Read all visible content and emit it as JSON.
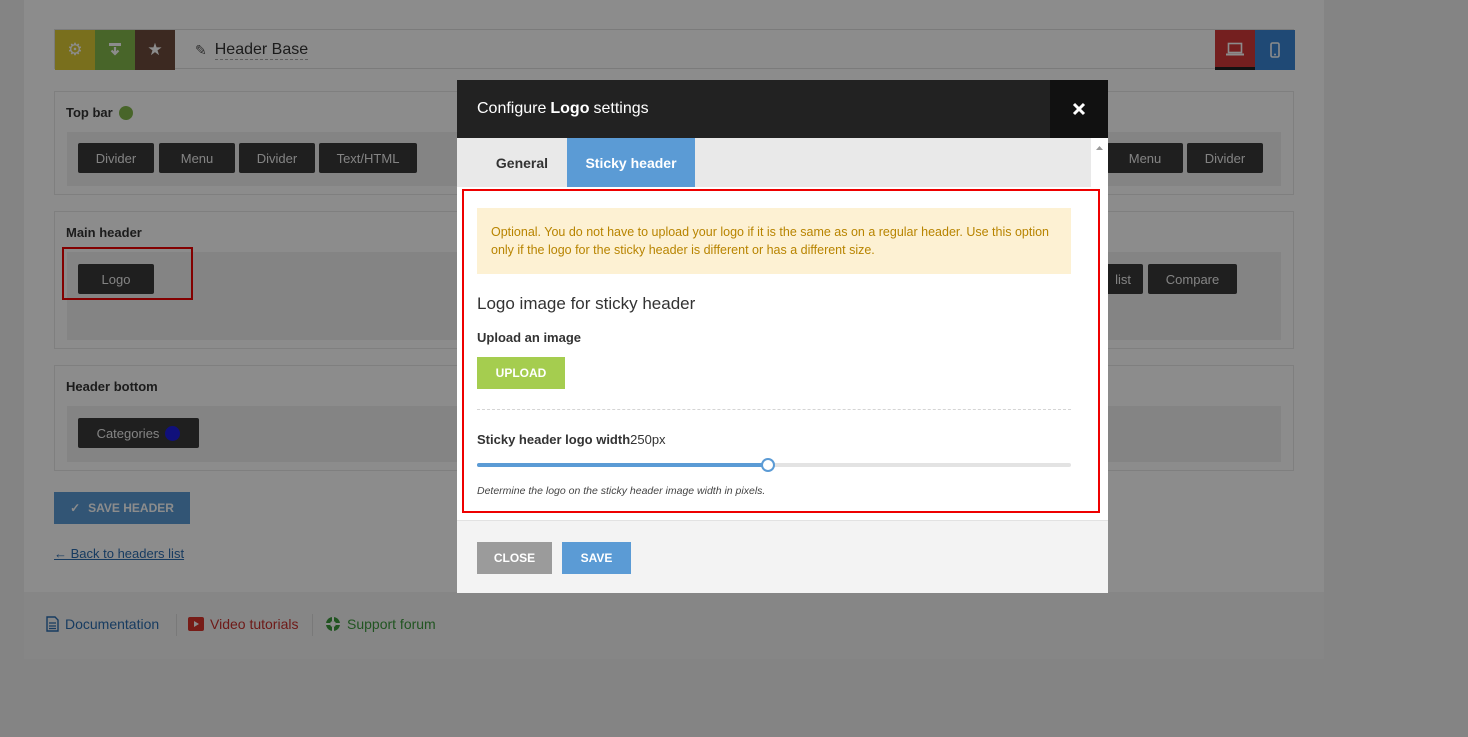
{
  "builder": {
    "title": "Header Base",
    "toolbar_colors": {
      "settings": "#dccb35",
      "import": "#84b84c",
      "favorite": "#6d4c3d",
      "desktop": "#d33a3a",
      "mobile": "#3a86d6"
    }
  },
  "sections": {
    "top_bar": {
      "label": "Top bar",
      "dot_color": "#84b84c",
      "left_items": [
        "Divider",
        "Menu",
        "Divider",
        "Text/HTML"
      ],
      "right_items": [
        "Menu",
        "Divider"
      ]
    },
    "main_header": {
      "label": "Main header",
      "left_items": [
        "Logo"
      ],
      "right_items": [
        "list",
        "Compare"
      ]
    },
    "header_bottom": {
      "label": "Header bottom",
      "left_item": "Categories",
      "dot_color": "#1e1ee0"
    }
  },
  "save_header_label": "SAVE HEADER",
  "back_link": "← Back to headers list",
  "footer_links": {
    "documentation": "Documentation",
    "video": "Video tutorials",
    "support": "Support forum"
  },
  "modal": {
    "title_prefix": "Configure",
    "title_bold": "Logo",
    "title_suffix": "settings",
    "tabs": [
      "General",
      "Sticky header"
    ],
    "active_tab": "Sticky header",
    "notice": "Optional. You do not have to upload your logo if it is the same as on a regular header. Use this option only if the logo for the sticky header is different or has a different size.",
    "section_title": "Logo image for sticky header",
    "upload_label": "Upload an image",
    "upload_button": "UPLOAD",
    "width_label": "Sticky header logo width",
    "width_value": "250px",
    "slider_fill": 0.49,
    "hint": "Determine the logo on the sticky header image width in pixels.",
    "close_button": "CLOSE",
    "save_button": "SAVE"
  }
}
